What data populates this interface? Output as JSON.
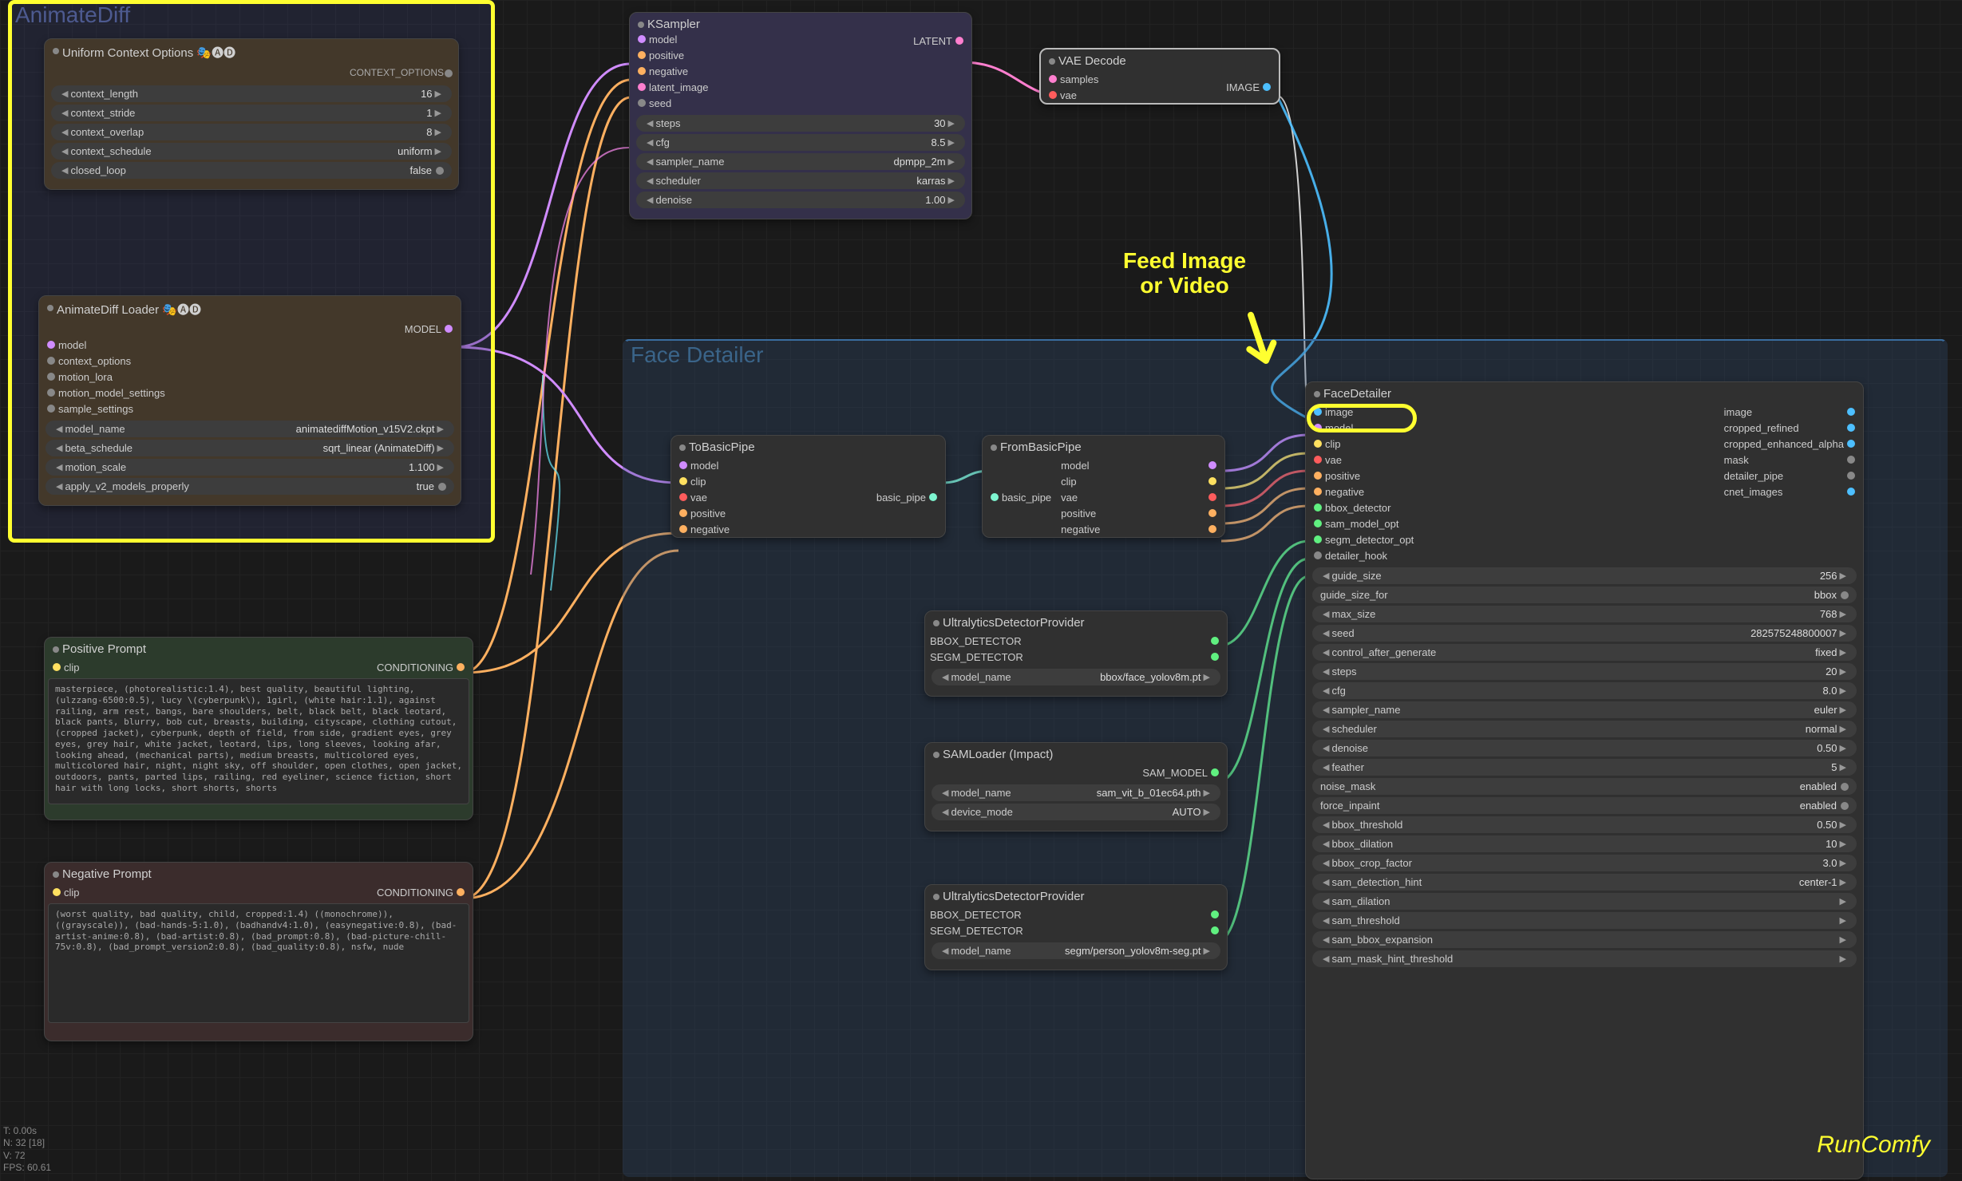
{
  "groups": {
    "animatediff": "AnimateDiff",
    "facedetailer": "Face Detailer"
  },
  "annotation": {
    "feed_line1": "Feed Image",
    "feed_line2": "or Video"
  },
  "watermark": "RunComfy",
  "hud": {
    "t": "T: 0.00s",
    "n": "N: 32 [18]",
    "v": "V: 72",
    "fps": "FPS: 60.61"
  },
  "uniformContext": {
    "title": "Uniform Context Options 🎭🅐🅓",
    "output": "CONTEXT_OPTIONS",
    "params": [
      {
        "name": "context_length",
        "val": "16"
      },
      {
        "name": "context_stride",
        "val": "1"
      },
      {
        "name": "context_overlap",
        "val": "8"
      },
      {
        "name": "context_schedule",
        "val": "uniform"
      },
      {
        "name": "closed_loop",
        "val": "false",
        "toggle": true
      }
    ]
  },
  "animLoader": {
    "title": "AnimateDiff Loader 🎭🅐🅓",
    "output": "MODEL",
    "inputs": [
      "model",
      "context_options",
      "motion_lora",
      "motion_model_settings",
      "sample_settings"
    ],
    "params": [
      {
        "name": "model_name",
        "val": "animatediffMotion_v15V2.ckpt"
      },
      {
        "name": "beta_schedule",
        "val": "sqrt_linear (AnimateDiff)"
      },
      {
        "name": "motion_scale",
        "val": "1.100"
      },
      {
        "name": "apply_v2_models_properly",
        "val": "true",
        "toggle": true
      }
    ]
  },
  "ksampler": {
    "title": "KSampler",
    "output": "LATENT",
    "inputs": [
      "model",
      "positive",
      "negative",
      "latent_image",
      "seed"
    ],
    "params": [
      {
        "name": "steps",
        "val": "30"
      },
      {
        "name": "cfg",
        "val": "8.5"
      },
      {
        "name": "sampler_name",
        "val": "dpmpp_2m"
      },
      {
        "name": "scheduler",
        "val": "karras"
      },
      {
        "name": "denoise",
        "val": "1.00"
      }
    ]
  },
  "vaeDecode": {
    "title": "VAE Decode",
    "output": "IMAGE",
    "inputs": [
      "samples",
      "vae"
    ]
  },
  "positive": {
    "title": "Positive Prompt",
    "input": "clip",
    "output": "CONDITIONING",
    "text": "masterpiece, (photorealistic:1.4), best quality, beautiful lighting, (ulzzang-6500:0.5), lucy \\(cyberpunk\\), 1girl, (white hair:1.1), against railing, arm rest, bangs, bare shoulders, belt, black belt, black leotard, black pants, blurry, bob cut, breasts, building, cityscape, clothing cutout, (cropped jacket), cyberpunk, depth of field, from side, gradient eyes, grey eyes, grey hair, white jacket, leotard, lips, long sleeves, looking afar, looking ahead, (mechanical parts), medium breasts, multicolored eyes, multicolored hair, night, night sky, off shoulder, open clothes, open jacket, outdoors, pants, parted lips, railing, red eyeliner, science fiction, short hair with long locks, short shorts, shorts"
  },
  "negative": {
    "title": "Negative Prompt",
    "input": "clip",
    "output": "CONDITIONING",
    "text": "(worst quality, bad quality, child, cropped:1.4) ((monochrome)), ((grayscale)), (bad-hands-5:1.0), (badhandv4:1.0), (easynegative:0.8), (bad-artist-anime:0.8), (bad-artist:0.8), (bad_prompt:0.8), (bad-picture-chill-75v:0.8), (bad_prompt_version2:0.8), (bad_quality:0.8), nsfw, nude"
  },
  "toBasicPipe": {
    "title": "ToBasicPipe",
    "output": "basic_pipe",
    "inputs": [
      "model",
      "clip",
      "vae",
      "positive",
      "negative"
    ]
  },
  "fromBasicPipe": {
    "title": "FromBasicPipe",
    "input": "basic_pipe",
    "outputs": [
      "model",
      "clip",
      "vae",
      "positive",
      "negative"
    ]
  },
  "ultra1": {
    "title": "UltralyticsDetectorProvider",
    "outputs": [
      "BBOX_DETECTOR",
      "SEGM_DETECTOR"
    ],
    "param": {
      "name": "model_name",
      "val": "bbox/face_yolov8m.pt"
    }
  },
  "samLoader": {
    "title": "SAMLoader (Impact)",
    "output": "SAM_MODEL",
    "params": [
      {
        "name": "model_name",
        "val": "sam_vit_b_01ec64.pth"
      },
      {
        "name": "device_mode",
        "val": "AUTO"
      }
    ]
  },
  "ultra2": {
    "title": "UltralyticsDetectorProvider",
    "outputs": [
      "BBOX_DETECTOR",
      "SEGM_DETECTOR"
    ],
    "param": {
      "name": "model_name",
      "val": "segm/person_yolov8m-seg.pt"
    }
  },
  "faceDetailer": {
    "title": "FaceDetailer",
    "inputs": [
      "image",
      "model",
      "clip",
      "vae",
      "positive",
      "negative",
      "bbox_detector",
      "sam_model_opt",
      "segm_detector_opt",
      "detailer_hook"
    ],
    "outputs": [
      "image",
      "cropped_refined",
      "cropped_enhanced_alpha",
      "mask",
      "detailer_pipe",
      "cnet_images"
    ],
    "params": [
      {
        "name": "guide_size",
        "val": "256"
      },
      {
        "name": "guide_size_for",
        "val": "bbox",
        "toggle": true,
        "noLeft": true
      },
      {
        "name": "max_size",
        "val": "768"
      },
      {
        "name": "seed",
        "val": "282575248800007"
      },
      {
        "name": "control_after_generate",
        "val": "fixed"
      },
      {
        "name": "steps",
        "val": "20"
      },
      {
        "name": "cfg",
        "val": "8.0"
      },
      {
        "name": "sampler_name",
        "val": "euler"
      },
      {
        "name": "scheduler",
        "val": "normal"
      },
      {
        "name": "denoise",
        "val": "0.50"
      },
      {
        "name": "feather",
        "val": "5"
      },
      {
        "name": "noise_mask",
        "val": "enabled",
        "toggle": true,
        "noLeft": true
      },
      {
        "name": "force_inpaint",
        "val": "enabled",
        "toggle": true,
        "noLeft": true
      },
      {
        "name": "bbox_threshold",
        "val": "0.50"
      },
      {
        "name": "bbox_dilation",
        "val": "10"
      },
      {
        "name": "bbox_crop_factor",
        "val": "3.0"
      },
      {
        "name": "sam_detection_hint",
        "val": "center-1"
      },
      {
        "name": "sam_dilation",
        "val": ""
      },
      {
        "name": "sam_threshold",
        "val": ""
      },
      {
        "name": "sam_bbox_expansion",
        "val": ""
      },
      {
        "name": "sam_mask_hint_threshold",
        "val": ""
      }
    ]
  }
}
